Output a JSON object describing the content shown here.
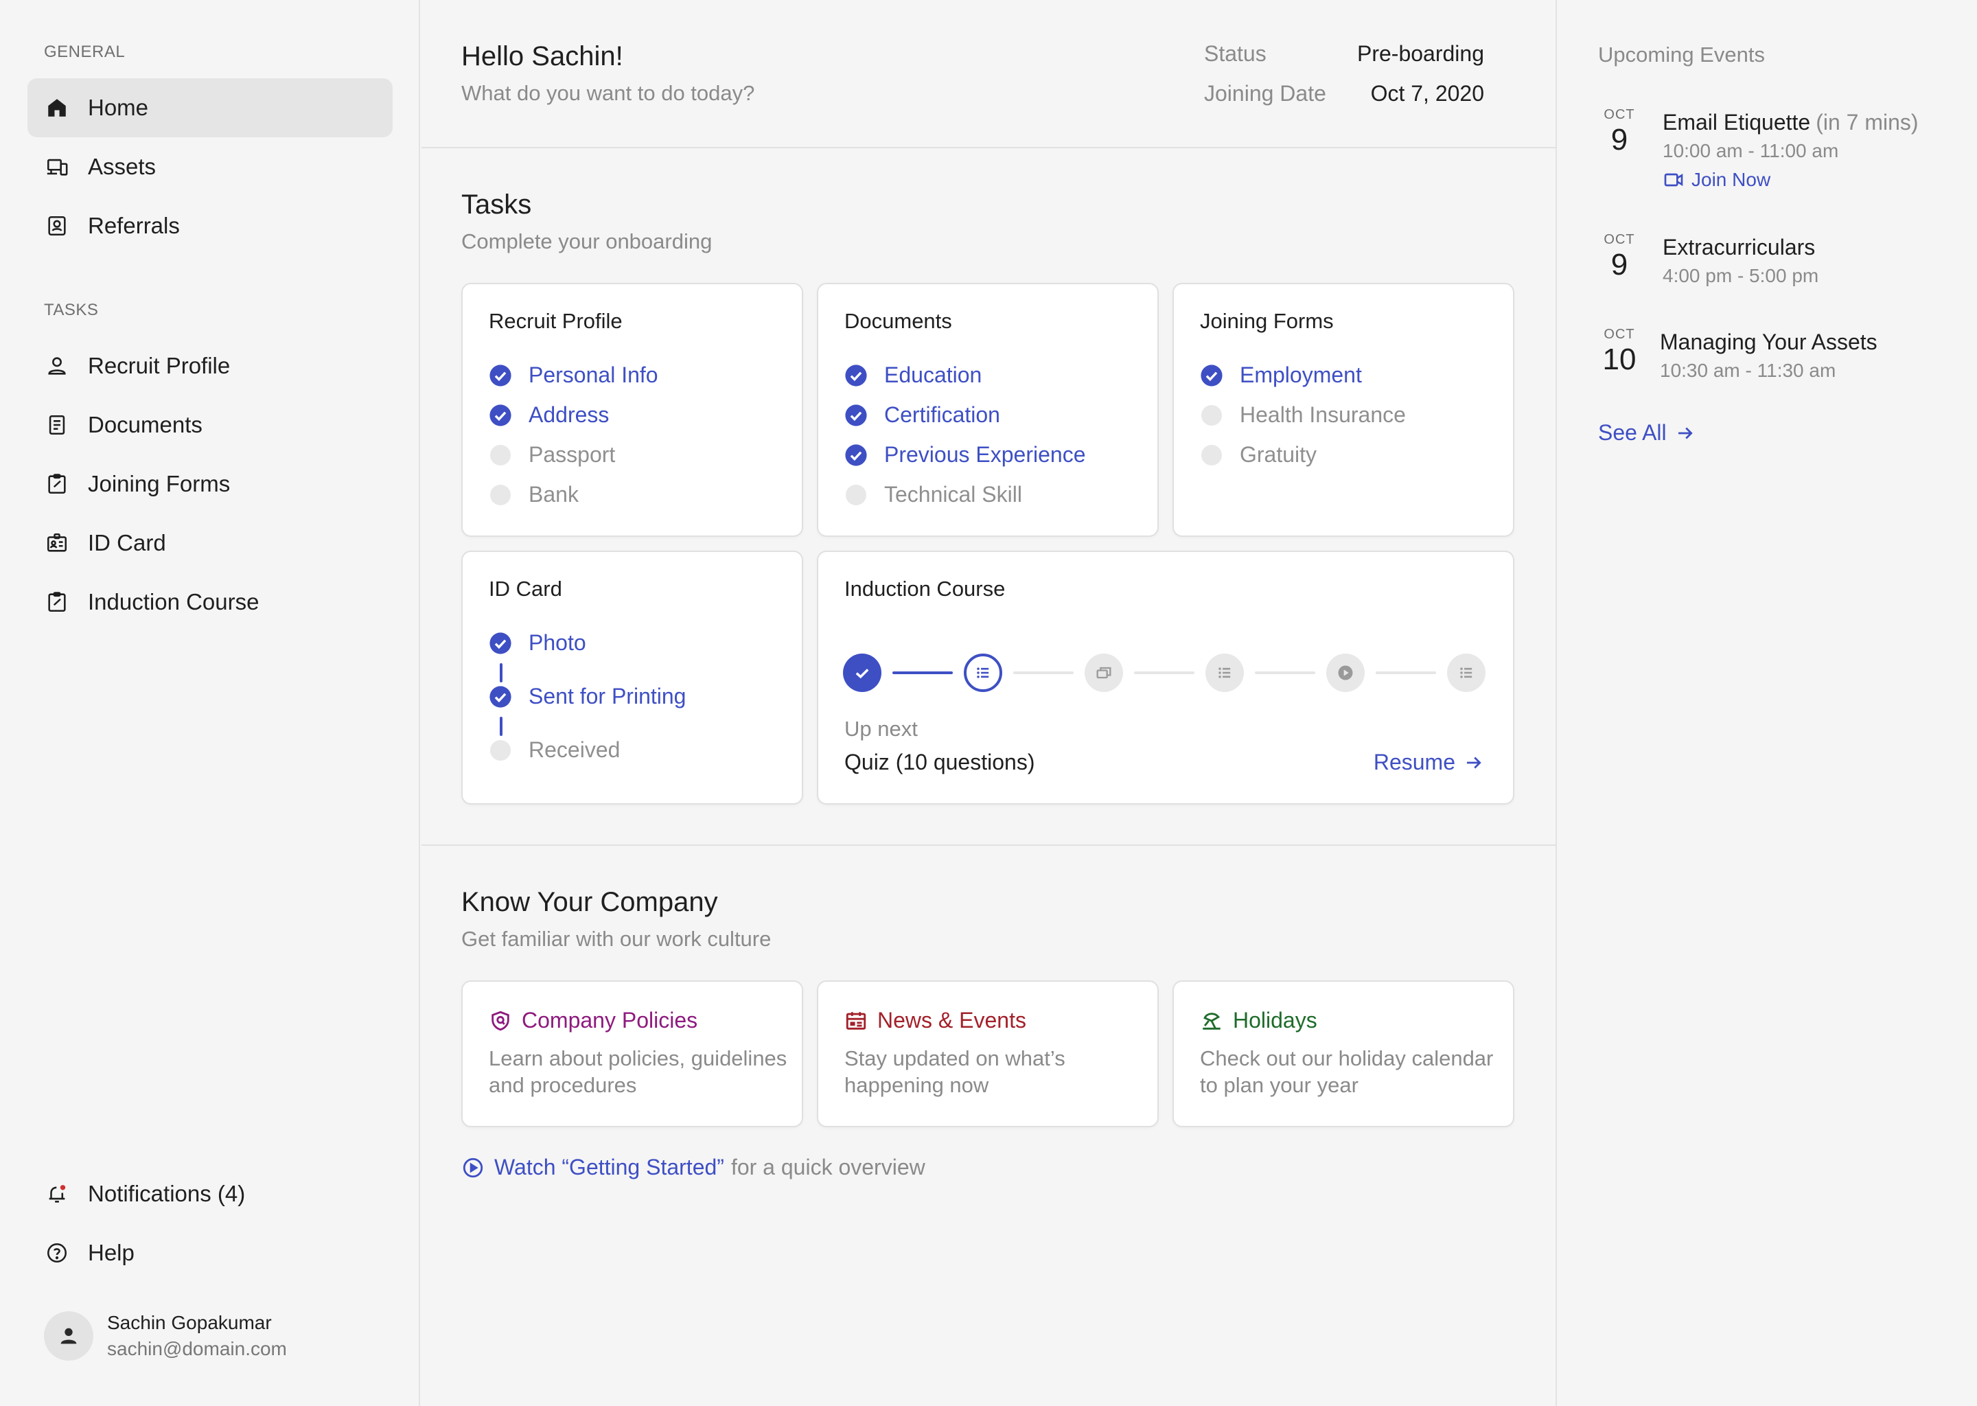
{
  "sidebar": {
    "general_label": "GENERAL",
    "general_items": [
      {
        "label": "Home",
        "icon": "home-icon",
        "active": true
      },
      {
        "label": "Assets",
        "icon": "devices-icon"
      },
      {
        "label": "Referrals",
        "icon": "contact-card-icon"
      }
    ],
    "tasks_label": "TASKS",
    "task_items": [
      {
        "label": "Recruit Profile",
        "icon": "person-icon"
      },
      {
        "label": "Documents",
        "icon": "document-icon"
      },
      {
        "label": "Joining Forms",
        "icon": "clipboard-icon"
      },
      {
        "label": "ID Card",
        "icon": "id-card-icon"
      },
      {
        "label": "Induction Course",
        "icon": "clipboard-check-icon"
      }
    ],
    "bottom_items": [
      {
        "label": "Notifications (4)",
        "icon": "bell-icon"
      },
      {
        "label": "Help",
        "icon": "help-circle-icon"
      }
    ],
    "user": {
      "name": "Sachin Gopakumar",
      "email": "sachin@domain.com"
    }
  },
  "header": {
    "greeting": "Hello Sachin!",
    "subtitle": "What do you want to do today?",
    "status_label": "Status",
    "status_value": "Pre-boarding",
    "joining_label": "Joining Date",
    "joining_value": "Oct 7, 2020"
  },
  "tasks": {
    "title": "Tasks",
    "subtitle": "Complete your onboarding",
    "recruit_profile": {
      "title": "Recruit Profile",
      "items": [
        {
          "label": "Personal Info",
          "done": true
        },
        {
          "label": "Address",
          "done": true
        },
        {
          "label": "Passport",
          "done": false
        },
        {
          "label": "Bank",
          "done": false
        }
      ]
    },
    "documents": {
      "title": "Documents",
      "items": [
        {
          "label": "Education",
          "done": true
        },
        {
          "label": "Certification",
          "done": true
        },
        {
          "label": "Previous Experience",
          "done": true
        },
        {
          "label": "Technical Skill",
          "done": false
        }
      ]
    },
    "joining_forms": {
      "title": "Joining Forms",
      "items": [
        {
          "label": "Employment",
          "done": true
        },
        {
          "label": "Health Insurance",
          "done": false
        },
        {
          "label": "Gratuity",
          "done": false
        }
      ]
    },
    "id_card": {
      "title": "ID Card",
      "items": [
        {
          "label": "Photo",
          "done": true
        },
        {
          "label": "Sent for Printing",
          "done": true
        },
        {
          "label": "Received",
          "done": false
        }
      ]
    },
    "induction": {
      "title": "Induction Course",
      "steps": [
        "done",
        "current",
        "future-slides",
        "future-list",
        "future-video",
        "future-list"
      ],
      "up_next_label": "Up next",
      "up_next_item": "Quiz (10 questions)",
      "resume_label": "Resume"
    }
  },
  "company": {
    "title": "Know Your Company",
    "subtitle": "Get familiar with our work culture",
    "cards": [
      {
        "title": "Company Policies",
        "desc": "Learn about policies, guidelines and procedures",
        "icon": "shield-icon",
        "color": "#8e1a7f"
      },
      {
        "title": "News & Events",
        "desc": "Stay updated on what’s happening now",
        "icon": "calendar-icon",
        "color": "#a3202a"
      },
      {
        "title": "Holidays",
        "desc": "Check out our holiday calendar to plan your year",
        "icon": "beach-icon",
        "color": "#1e6b2a"
      }
    ],
    "watch_link": "Watch “Getting Started”",
    "watch_rest": "for a quick overview"
  },
  "events": {
    "title": "Upcoming Events",
    "items": [
      {
        "month": "OCT",
        "day": "9",
        "name": "Email Etiquette",
        "soon": "(in 7 mins)",
        "time": "10:00 am - 11:00 am",
        "join": "Join Now"
      },
      {
        "month": "OCT",
        "day": "9",
        "name": "Extracurriculars",
        "time": "4:00 pm - 5:00 pm"
      },
      {
        "month": "OCT",
        "day": "10",
        "name": "Managing Your Assets",
        "time": "10:30 am - 11:30 am"
      }
    ],
    "see_all": "See All"
  },
  "colors": {
    "accent": "#3e4fc4",
    "muted": "#8a8a8a",
    "done": "#3e4fc4",
    "todo": "#e8e8e8"
  }
}
